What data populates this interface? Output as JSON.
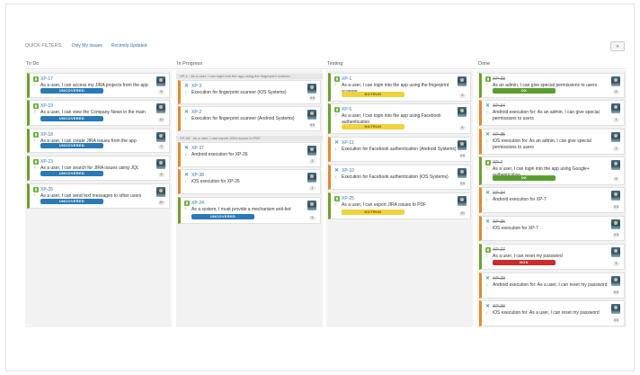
{
  "quick_filters": {
    "label": "QUICK FILTERS:",
    "only_my_issues": "Only My Issues",
    "recently_updated": "Recently Updated"
  },
  "collapse_button": "»",
  "columns": {
    "todo": "To Do",
    "progress": "In Progress",
    "testing": "Testing",
    "done": "Done"
  },
  "todo_cards": [
    {
      "key": "XP-17",
      "summary": "As a user, I can access my JIRA projects from the app",
      "badge": "UNCOVERED",
      "est": "5"
    },
    {
      "key": "XP-19",
      "summary": "As a user, I can view the Company News in the main page",
      "badge": "UNCOVERED",
      "est": "10"
    },
    {
      "key": "XP-18",
      "summary": "As a user, I can create JIRA issues from the app",
      "badge": "UNCOVERED",
      "est": "3"
    },
    {
      "key": "XP-23",
      "summary": "As a user, I can search for JIRA issues using JQL",
      "badge": "UNCOVERED",
      "est": "8"
    },
    {
      "key": "XP-26",
      "summary": "As a user, I can send text messages to other users",
      "badge": "UNCOVERED",
      "est": "20"
    }
  ],
  "progress_groups": [
    "XP-1 · As a user, I can login into the app using the fingerprint scanner",
    "XP-28 · As a user, I can export JIRA issues to PDF"
  ],
  "progress_cards": [
    {
      "key": "XP-3",
      "summary": "Execution for fingerprint scanner (iOS Systems)",
      "est": "0.5"
    },
    {
      "key": "XP-2",
      "summary": "Execution for fingerprint scanner (Android Systems)",
      "est": "0.5"
    },
    {
      "key": "XP-37",
      "summary": "Android execution for XP-26",
      "est": "1"
    },
    {
      "key": "XP-38",
      "summary": "iOS execution for XP-26",
      "est": "1"
    },
    {
      "key": "XP-24",
      "summary": "As a system, I must provide a mechanism anti-bot",
      "badge": "UNCOVERED",
      "est": "5"
    }
  ],
  "testing_cards": [
    {
      "key": "XP-1",
      "summary": "As a user, I can login into the app using the fingerprint scanner",
      "badge": "NOTRUN",
      "est": "5"
    },
    {
      "key": "XP-5",
      "summary": "As a user, I can login into the app using Facebook authentication",
      "badge": "NOTRUN",
      "est": "5"
    },
    {
      "key": "XP-11",
      "summary": "Execution for Facebook authentication (Android Systems)",
      "est": "0.5"
    },
    {
      "key": "XP-10",
      "summary": "Execution for Facebook authentication (iOS Systems)",
      "est": "0.5"
    },
    {
      "key": "XP-25",
      "summary": "As a user, I can export JIRA issues to PDF",
      "badge": "NOTRUN",
      "est": "10"
    }
  ],
  "done_cards": [
    {
      "key": "XP-33",
      "summary": "As an admin, I can give special permissions to users",
      "badge": "OK",
      "est": "5"
    },
    {
      "key": "XP-34",
      "summary": "Android execution for: As an admin, I can give special permissions to users",
      "est": "1"
    },
    {
      "key": "XP-35",
      "summary": "iOS execution for: As an admin, I can give special permissions to users",
      "est": "1"
    },
    {
      "key": "XP-7",
      "summary": "As a user, I can login into the app using Google+ authentication",
      "badge": "OK",
      "est": "5"
    },
    {
      "key": "XP-34",
      "summary": "Android execution for XP-7",
      "est": "0.5"
    },
    {
      "key": "XP-36",
      "summary": "iOS execution for XP-7",
      "est": "0.5"
    },
    {
      "key": "XP-27",
      "summary": "As a user, I can reset my password",
      "badge": "NOK",
      "est": "5"
    },
    {
      "key": "XP-29",
      "summary": "Android execution for: As a user, I can reset my password",
      "est": "0.5"
    },
    {
      "key": "XP-30",
      "summary": "iOS execution for: As a user, I can reset my password",
      "est": "0.5"
    }
  ],
  "colors": {
    "link": "#3572b0",
    "story_border": "#6f9e2e",
    "subtask_border": "#e08a2e",
    "uncovered": "#2a79b8",
    "notrun": "#f0d23c",
    "ok": "#5a9e2f",
    "nok": "#cf2a2a"
  },
  "icons": {
    "story": "story-icon",
    "test_execution": "test-execution-icon",
    "priority": "priority-up-icon",
    "avatar": "user-avatar"
  }
}
